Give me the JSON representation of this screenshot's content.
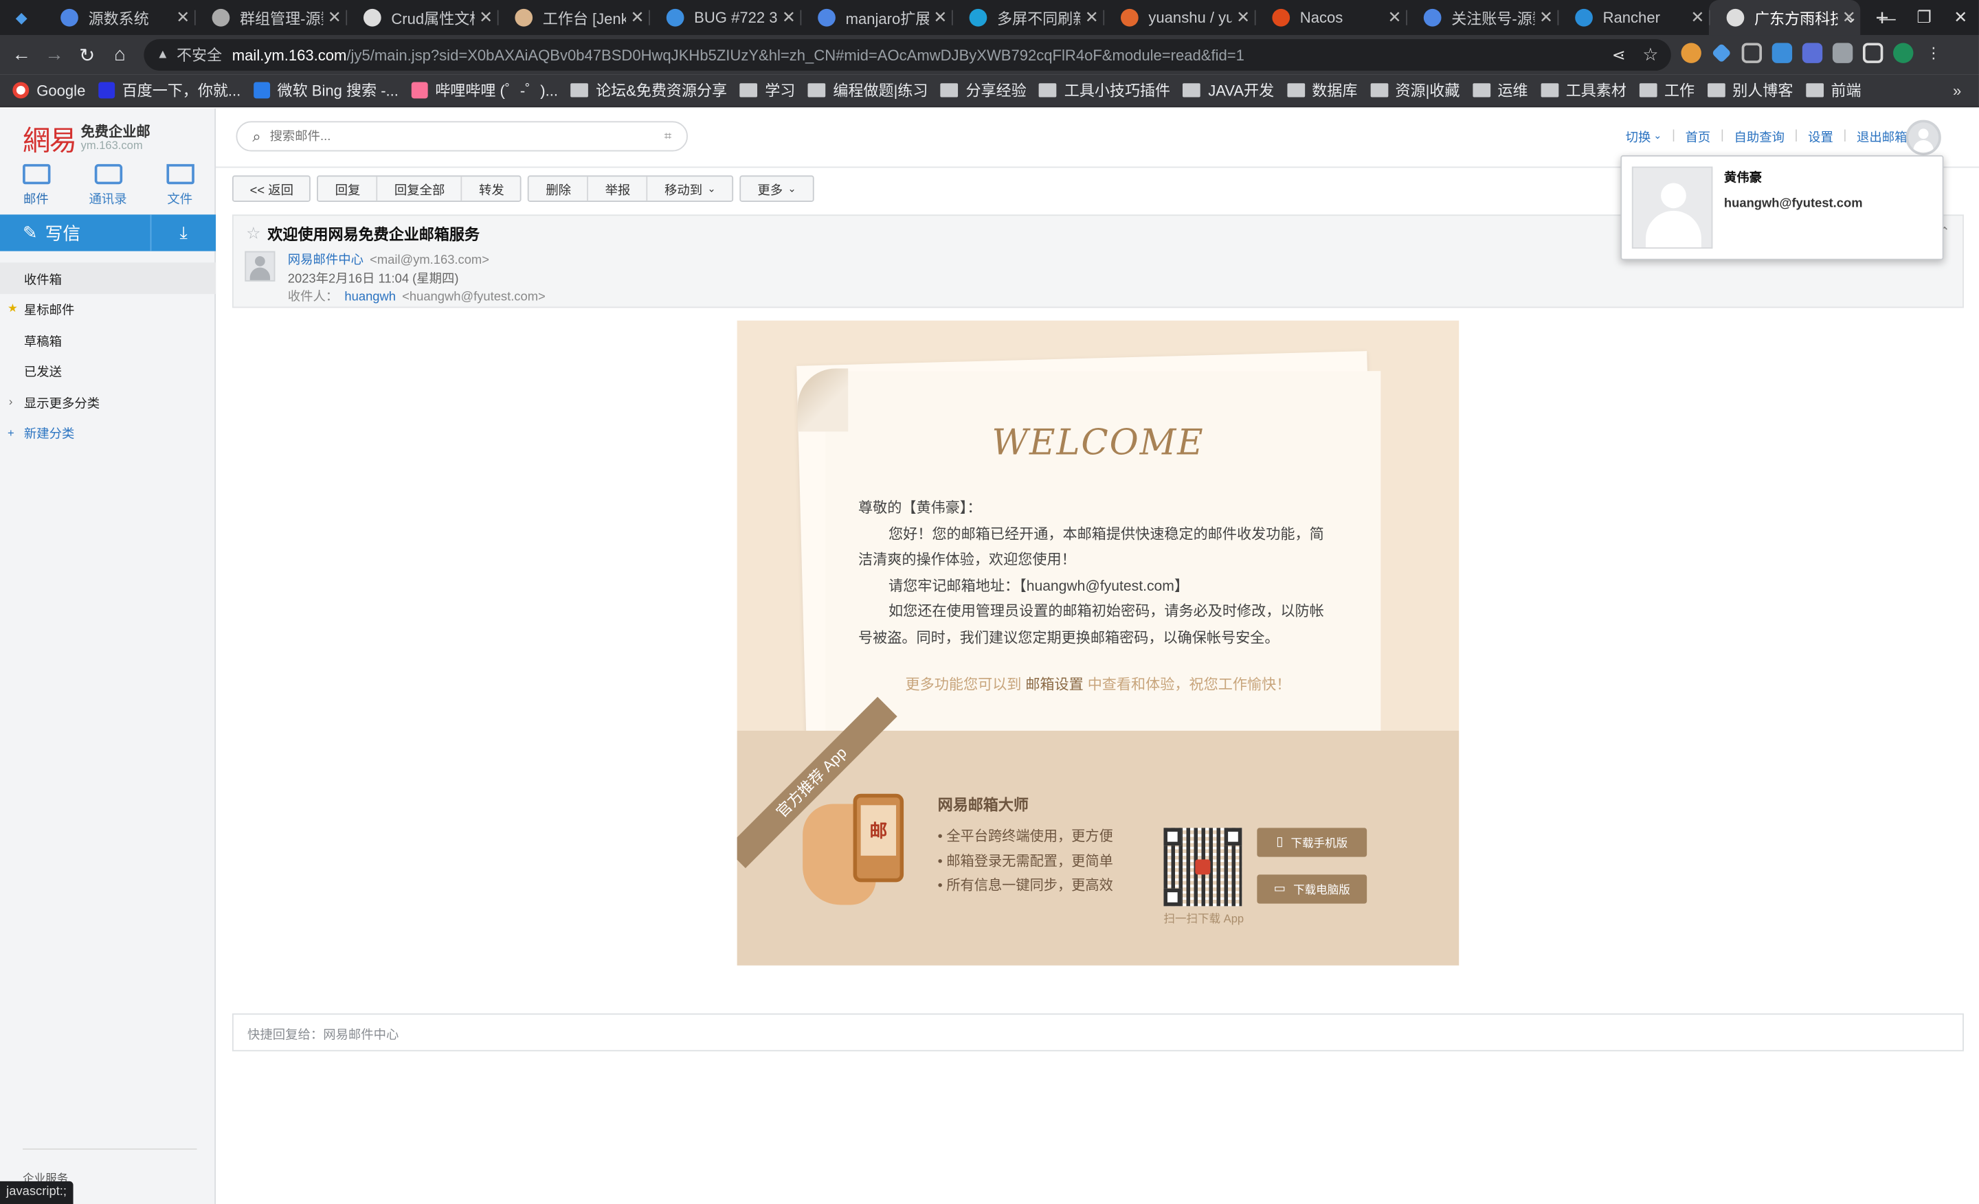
{
  "browser": {
    "tabs": [
      {
        "title": "源数系统",
        "color": "#4e86e4"
      },
      {
        "title": "群组管理-源数",
        "color": "#aaaaaa"
      },
      {
        "title": "Crud属性文档",
        "color": "#dddddd"
      },
      {
        "title": "工作台 [Jenkins]",
        "color": "#d9b48c"
      },
      {
        "title": "BUG #722 3",
        "color": "#3d8fe0"
      },
      {
        "title": "manjaro扩展",
        "color": "#4e86e4"
      },
      {
        "title": "多屏不同刷新",
        "color": "#1ea0d8"
      },
      {
        "title": "yuanshu / yuan",
        "color": "#e1672d"
      },
      {
        "title": "Nacos",
        "color": "#e04a1a"
      },
      {
        "title": "关注账号-源数",
        "color": "#4e86e4"
      },
      {
        "title": "Rancher",
        "color": "#2a8ed9"
      },
      {
        "title": "广东方雨科技",
        "color": "#dddddd"
      }
    ],
    "new_tab": "+",
    "win_controls": [
      "⌄",
      "—",
      "❐",
      "✕"
    ],
    "insecure_label": "不安全",
    "url_host": "mail.ym.163.com",
    "url_path": "/jy5/main.jsp?sid=X0bAXAiAQBv0b47BSD0HwqJKHb5ZIUzY&hl=zh_CN#mid=AOcAmwDJByXWB792cqFlR4oF&module=read&fid=1",
    "bookmarks": [
      {
        "label": "Google",
        "type": "google"
      },
      {
        "label": "百度一下，你就...",
        "type": "site",
        "color": "#2932e1"
      },
      {
        "label": "微软 Bing 搜索 -...",
        "type": "site",
        "color": "#2b7de9"
      },
      {
        "label": "哔哩哔哩 (゜-゜)...",
        "type": "site",
        "color": "#fb7299"
      },
      {
        "label": "论坛&免费资源分享",
        "type": "folder"
      },
      {
        "label": "学习",
        "type": "folder"
      },
      {
        "label": "编程做题|练习",
        "type": "folder"
      },
      {
        "label": "分享经验",
        "type": "folder"
      },
      {
        "label": "工具小技巧插件",
        "type": "folder"
      },
      {
        "label": "JAVA开发",
        "type": "folder"
      },
      {
        "label": "数据库",
        "type": "folder"
      },
      {
        "label": "资源|收藏",
        "type": "folder"
      },
      {
        "label": "运维",
        "type": "folder"
      },
      {
        "label": "工具素材",
        "type": "folder"
      },
      {
        "label": "工作",
        "type": "folder"
      },
      {
        "label": "别人博客",
        "type": "folder"
      },
      {
        "label": "前端",
        "type": "folder"
      }
    ],
    "bookmarks_more": "»",
    "status_text": "javascript:;"
  },
  "sidebar": {
    "logo_cn": "網易",
    "logo_title": "免费企业邮",
    "logo_domain": "ym.163.com",
    "nav": [
      {
        "label": "邮件",
        "icon": "mail-icon"
      },
      {
        "label": "通讯录",
        "icon": "contacts-icon"
      },
      {
        "label": "文件",
        "icon": "folder-icon"
      }
    ],
    "write_label": "写信",
    "folders": [
      "收件箱",
      "星标邮件",
      "草稿箱",
      "已发送",
      "显示更多分类",
      "新建分类"
    ],
    "footer": "企业服务"
  },
  "header": {
    "search_placeholder": "搜索邮件...",
    "links": [
      "切换",
      "首页",
      "自助查询",
      "设置",
      "退出邮箱"
    ]
  },
  "actions": {
    "back": "<< 返回",
    "reply": "回复",
    "reply_all": "回复全部",
    "forward": "转发",
    "delete": "删除",
    "report": "举报",
    "move": "移动到",
    "more": "更多"
  },
  "mail": {
    "subject": "欢迎使用网易免费企业邮箱服务",
    "from_name": "网易邮件中心",
    "from_addr": "<mail@ym.163.com>",
    "date": "2023年2月16日 11:04 (星期四)",
    "to_label": "收件人：",
    "to_name": "huangwh",
    "to_addr": "<huangwh@fyutest.com>"
  },
  "popup": {
    "name": "黄伟豪",
    "email": "huangwh@fyutest.com"
  },
  "body": {
    "welcome": "WELCOME",
    "greeting": "尊敬的【黄伟豪】：",
    "p1": "您好！您的邮箱已经开通，本邮箱提供快速稳定的邮件收发功能，简洁清爽的操作体验，欢迎您使用！",
    "p2": "请您牢记邮箱地址：【huangwh@fyutest.com】",
    "p3": "如您还在使用管理员设置的邮箱初始密码，请务必及时修改，以防帐号被盗。同时，我们建议您定期更换邮箱密码，以确保帐号安全。",
    "promo_pre": "更多功能您可以到",
    "promo_link": "邮箱设置",
    "promo_post": "中查看和体验，祝您工作愉快！",
    "ribbon": "官方推荐 App",
    "phone_glyph": "邮",
    "app_title": "网易邮箱大师",
    "features": [
      "• 全平台跨终端使用，更方便",
      "• 邮箱登录无需配置，更简单",
      "• 所有信息一键同步，更高效"
    ],
    "qr_caption": "扫一扫下载 App",
    "dl_mobile": "下载手机版",
    "dl_pc": "下载电脑版"
  },
  "quick_reply": "快捷回复给：网易邮件中心"
}
